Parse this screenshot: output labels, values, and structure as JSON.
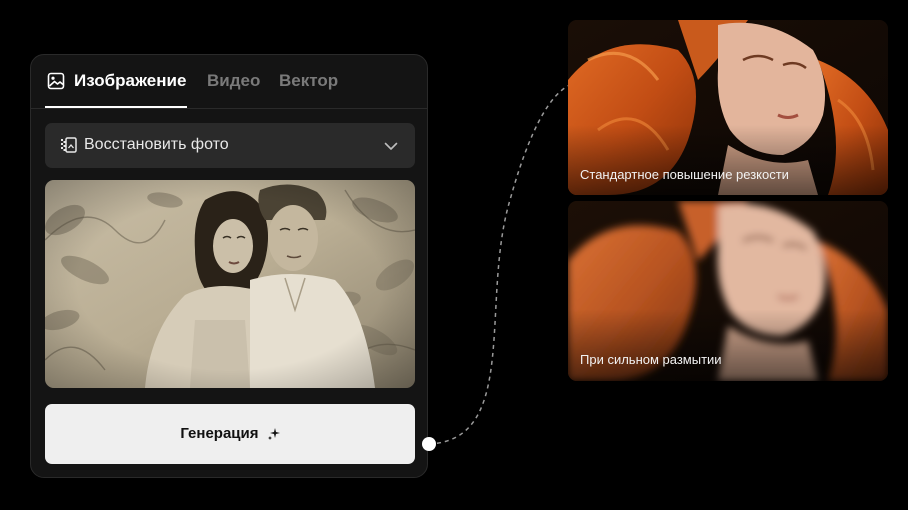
{
  "tabs": {
    "image": "Изображение",
    "video": "Видео",
    "vector": "Вектор"
  },
  "mode_select": {
    "label": "Восстановить фото",
    "icon": "restore-photo-icon"
  },
  "generate_button": {
    "label": "Генерация",
    "icon": "sparkle-icon"
  },
  "results": [
    {
      "caption": "Стандартное повышение резкости"
    },
    {
      "caption": "При сильном размытии"
    }
  ],
  "colors": {
    "background": "#000000",
    "panel": "#141414",
    "select": "#2a2a2a",
    "button": "#efefef",
    "inactive_tab": "#7a7a7a"
  }
}
